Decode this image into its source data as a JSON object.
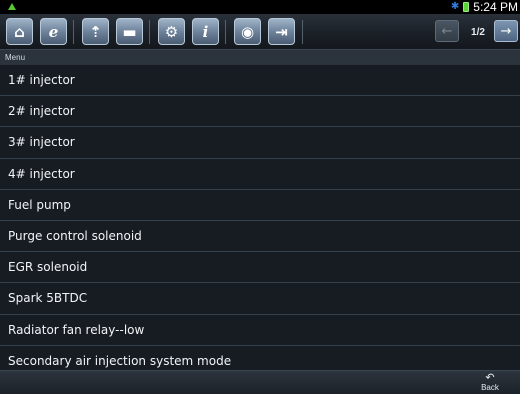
{
  "status_bar": {
    "time": "5:24 PM",
    "left_icon": "signal-triangle-icon",
    "right_icons": [
      "bluetooth-icon",
      "battery-icon"
    ]
  },
  "toolbar": {
    "buttons": [
      {
        "icon": "home-icon",
        "glyph": "⌂"
      },
      {
        "icon": "browser-icon",
        "glyph": "e"
      },
      {
        "icon": "vehicle-lift-icon",
        "glyph": "⇡"
      },
      {
        "icon": "message-icon",
        "glyph": "▬"
      },
      {
        "icon": "settings-icon",
        "glyph": "⚙"
      },
      {
        "icon": "info-icon",
        "glyph": "i"
      },
      {
        "icon": "camera-icon",
        "glyph": "◉"
      },
      {
        "icon": "exit-icon",
        "glyph": "⇥"
      }
    ],
    "prev_icon": "arrow-left-icon",
    "next_icon": "arrow-right-icon",
    "prev_glyph": "←",
    "next_glyph": "→",
    "page_indicator": "1/2"
  },
  "menu_header": "Menu",
  "items": [
    "1# injector",
    "2# injector",
    "3# injector",
    "4# injector",
    "Fuel pump",
    "Purge control solenoid",
    "EGR solenoid",
    "Spark 5BTDC",
    "Radiator fan relay--low",
    "Secondary air injection system mode"
  ],
  "bottom_bar": {
    "back_label": "Back",
    "back_icon": "back-arrow-icon",
    "back_glyph": "↶"
  },
  "colors": {
    "toolbar_button": "#6a7f97",
    "list_background": "#171c23",
    "separator": "#34404c",
    "battery": "#58d534",
    "bluetooth": "#2f7de0"
  }
}
